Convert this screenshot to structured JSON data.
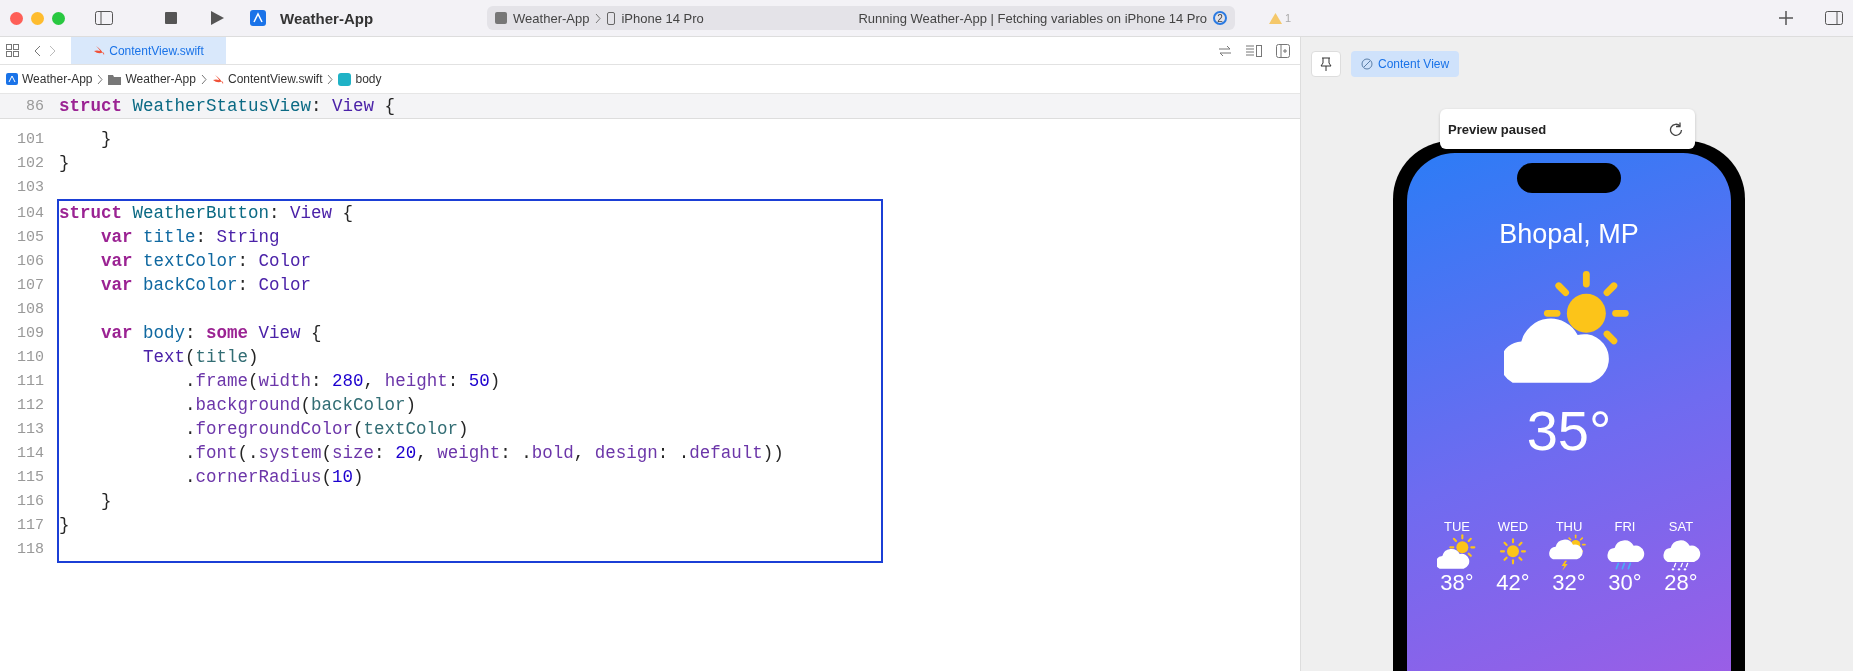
{
  "toolbar": {
    "project": "Weather-App",
    "scheme": "Weather-App",
    "device": "iPhone 14 Pro",
    "status": "Running Weather-App | Fetching variables on iPhone 14 Pro",
    "status_badge": "2",
    "warnings": "1"
  },
  "tabs": [
    {
      "label": "ContentView.swift",
      "selected": true
    }
  ],
  "breadcrumbs": [
    {
      "label": "Weather-App",
      "kind": "project"
    },
    {
      "label": "Weather-App",
      "kind": "folder"
    },
    {
      "label": "ContentView.swift",
      "kind": "swift"
    },
    {
      "label": "body",
      "kind": "property"
    }
  ],
  "sticky_line": {
    "number": "86",
    "tokens": [
      {
        "kind": "keyword",
        "text": "struct"
      },
      {
        "kind": "type_decl",
        "text": " WeatherStatusView"
      },
      {
        "kind": "plain",
        "text": ":"
      },
      {
        "kind": "type",
        "text": " View"
      },
      {
        "kind": "plain",
        "text": " {"
      }
    ]
  },
  "code_lines": [
    {
      "number": "101",
      "selected": false,
      "tokens": [
        {
          "kind": "plain",
          "text": "    }"
        }
      ]
    },
    {
      "number": "102",
      "selected": false,
      "tokens": [
        {
          "kind": "plain",
          "text": "}"
        }
      ]
    },
    {
      "number": "103",
      "selected": false
    },
    {
      "number": "104",
      "selected": true,
      "tokens": [
        {
          "kind": "keyword",
          "text": "struct"
        },
        {
          "kind": "type_decl",
          "text": " WeatherButton"
        },
        {
          "kind": "plain",
          "text": ":"
        },
        {
          "kind": "type",
          "text": " View"
        },
        {
          "kind": "plain",
          "text": " {"
        }
      ]
    },
    {
      "number": "105",
      "selected": true,
      "tokens": [
        {
          "kind": "keyword",
          "text": "    var"
        },
        {
          "kind": "prop_decl",
          "text": " title"
        },
        {
          "kind": "plain",
          "text": ":"
        },
        {
          "kind": "type",
          "text": " String"
        }
      ]
    },
    {
      "number": "106",
      "selected": true,
      "tokens": [
        {
          "kind": "keyword",
          "text": "    var"
        },
        {
          "kind": "prop_decl",
          "text": " textColor"
        },
        {
          "kind": "plain",
          "text": ":"
        },
        {
          "kind": "type",
          "text": " Color"
        }
      ]
    },
    {
      "number": "107",
      "selected": true,
      "tokens": [
        {
          "kind": "keyword",
          "text": "    var"
        },
        {
          "kind": "prop_decl",
          "text": " backColor"
        },
        {
          "kind": "plain",
          "text": ":"
        },
        {
          "kind": "type",
          "text": " Color"
        }
      ]
    },
    {
      "number": "108",
      "selected": true
    },
    {
      "number": "109",
      "selected": true,
      "tokens": [
        {
          "kind": "keyword",
          "text": "    var"
        },
        {
          "kind": "prop_decl",
          "text": " body"
        },
        {
          "kind": "plain",
          "text": ":"
        },
        {
          "kind": "keyword",
          "text": " some"
        },
        {
          "kind": "type",
          "text": " View"
        },
        {
          "kind": "plain",
          "text": " {"
        }
      ]
    },
    {
      "number": "110",
      "selected": true,
      "tokens": [
        {
          "kind": "type",
          "text": "        Text"
        },
        {
          "kind": "plain",
          "text": "("
        },
        {
          "kind": "prop",
          "text": "title"
        },
        {
          "kind": "plain",
          "text": ")"
        }
      ]
    },
    {
      "number": "111",
      "selected": true,
      "tokens": [
        {
          "kind": "plain",
          "text": "            ."
        },
        {
          "kind": "method",
          "text": "frame"
        },
        {
          "kind": "plain",
          "text": "("
        },
        {
          "kind": "method",
          "text": "width"
        },
        {
          "kind": "plain",
          "text": ":"
        },
        {
          "kind": "number",
          "text": " 280"
        },
        {
          "kind": "plain",
          "text": ","
        },
        {
          "kind": "method",
          "text": " height"
        },
        {
          "kind": "plain",
          "text": ":"
        },
        {
          "kind": "number",
          "text": " 50"
        },
        {
          "kind": "plain",
          "text": ")"
        }
      ]
    },
    {
      "number": "112",
      "selected": true,
      "tokens": [
        {
          "kind": "plain",
          "text": "            ."
        },
        {
          "kind": "method",
          "text": "background"
        },
        {
          "kind": "plain",
          "text": "("
        },
        {
          "kind": "prop",
          "text": "backColor"
        },
        {
          "kind": "plain",
          "text": ")"
        }
      ]
    },
    {
      "number": "113",
      "selected": true,
      "tokens": [
        {
          "kind": "plain",
          "text": "            ."
        },
        {
          "kind": "method",
          "text": "foregroundColor"
        },
        {
          "kind": "plain",
          "text": "("
        },
        {
          "kind": "prop",
          "text": "textColor"
        },
        {
          "kind": "plain",
          "text": ")"
        }
      ]
    },
    {
      "number": "114",
      "selected": true,
      "tokens": [
        {
          "kind": "plain",
          "text": "            ."
        },
        {
          "kind": "method",
          "text": "font"
        },
        {
          "kind": "plain",
          "text": "(."
        },
        {
          "kind": "method",
          "text": "system"
        },
        {
          "kind": "plain",
          "text": "("
        },
        {
          "kind": "method",
          "text": "size"
        },
        {
          "kind": "plain",
          "text": ":"
        },
        {
          "kind": "number",
          "text": " 20"
        },
        {
          "kind": "plain",
          "text": ","
        },
        {
          "kind": "method",
          "text": " weight"
        },
        {
          "kind": "plain",
          "text": ": ."
        },
        {
          "kind": "method",
          "text": "bold"
        },
        {
          "kind": "plain",
          "text": ","
        },
        {
          "kind": "method",
          "text": " design"
        },
        {
          "kind": "plain",
          "text": ": ."
        },
        {
          "kind": "method",
          "text": "default"
        },
        {
          "kind": "plain",
          "text": "))"
        }
      ]
    },
    {
      "number": "115",
      "selected": true,
      "tokens": [
        {
          "kind": "plain",
          "text": "            ."
        },
        {
          "kind": "method",
          "text": "cornerRadius"
        },
        {
          "kind": "plain",
          "text": "("
        },
        {
          "kind": "number",
          "text": "10"
        },
        {
          "kind": "plain",
          "text": ")"
        }
      ]
    },
    {
      "number": "116",
      "selected": true,
      "tokens": [
        {
          "kind": "plain",
          "text": "    }"
        }
      ]
    },
    {
      "number": "117",
      "selected": true,
      "tokens": [
        {
          "kind": "plain",
          "text": "}"
        }
      ]
    },
    {
      "number": "118",
      "selected": true
    }
  ],
  "preview": {
    "pinned": false,
    "chip": {
      "label": "Content View",
      "selected": true
    },
    "notice": "Preview paused",
    "city": "Bhopal, MP",
    "kind": "partly_sunny",
    "temperature": "35°",
    "forecast": [
      {
        "day": "TUE",
        "kind": "partly_sunny",
        "temp": "38°"
      },
      {
        "day": "WED",
        "kind": "sunny",
        "temp": "42°"
      },
      {
        "day": "THU",
        "kind": "thunder",
        "temp": "32°"
      },
      {
        "day": "FRI",
        "kind": "rain",
        "temp": "30°"
      },
      {
        "day": "SAT",
        "kind": "sleet",
        "temp": "28°"
      }
    ]
  }
}
